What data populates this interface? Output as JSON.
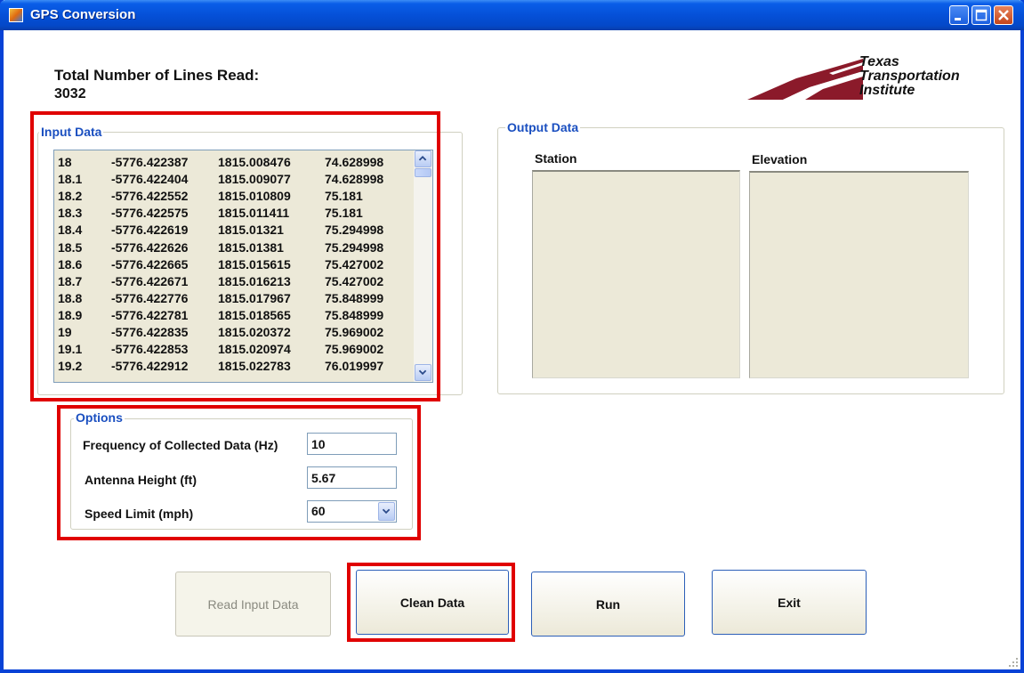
{
  "window": {
    "title": "GPS Conversion"
  },
  "summary": {
    "label": "Total Number of Lines Read:",
    "value": "3032"
  },
  "logo": {
    "line1": "Texas",
    "line2": "Transportation",
    "line3": "Institute"
  },
  "input_data": {
    "legend": "Input Data",
    "rows": [
      [
        "18",
        "-5776.422387",
        "1815.008476",
        "74.628998"
      ],
      [
        "18.1",
        "-5776.422404",
        "1815.009077",
        "74.628998"
      ],
      [
        "18.2",
        "-5776.422552",
        "1815.010809",
        "75.181"
      ],
      [
        "18.3",
        "-5776.422575",
        "1815.011411",
        "75.181"
      ],
      [
        "18.4",
        "-5776.422619",
        "1815.01321",
        "75.294998"
      ],
      [
        "18.5",
        "-5776.422626",
        "1815.01381",
        "75.294998"
      ],
      [
        "18.6",
        "-5776.422665",
        "1815.015615",
        "75.427002"
      ],
      [
        "18.7",
        "-5776.422671",
        "1815.016213",
        "75.427002"
      ],
      [
        "18.8",
        "-5776.422776",
        "1815.017967",
        "75.848999"
      ],
      [
        "18.9",
        "-5776.422781",
        "1815.018565",
        "75.848999"
      ],
      [
        "19",
        "-5776.422835",
        "1815.020372",
        "75.969002"
      ],
      [
        "19.1",
        "-5776.422853",
        "1815.020974",
        "75.969002"
      ],
      [
        "19.2",
        "-5776.422912",
        "1815.022783",
        "76.019997"
      ]
    ]
  },
  "output_data": {
    "legend": "Output Data",
    "station_header": "Station",
    "elevation_header": "Elevation"
  },
  "options": {
    "legend": "Options",
    "frequency_label": "Frequency of Collected Data (Hz)",
    "frequency_value": "10",
    "antenna_label": "Antenna Height (ft)",
    "antenna_value": "5.67",
    "speed_label": "Speed Limit (mph)",
    "speed_value": "60"
  },
  "buttons": {
    "read": "Read Input Data",
    "clean": "Clean Data",
    "run": "Run",
    "exit": "Exit"
  },
  "colors": {
    "titlebar": "#0550d8",
    "legend_text": "#1a4fc0",
    "highlight": "#e00000",
    "list_bg": "#ece9d8",
    "logo_red": "#8b1a2a"
  }
}
